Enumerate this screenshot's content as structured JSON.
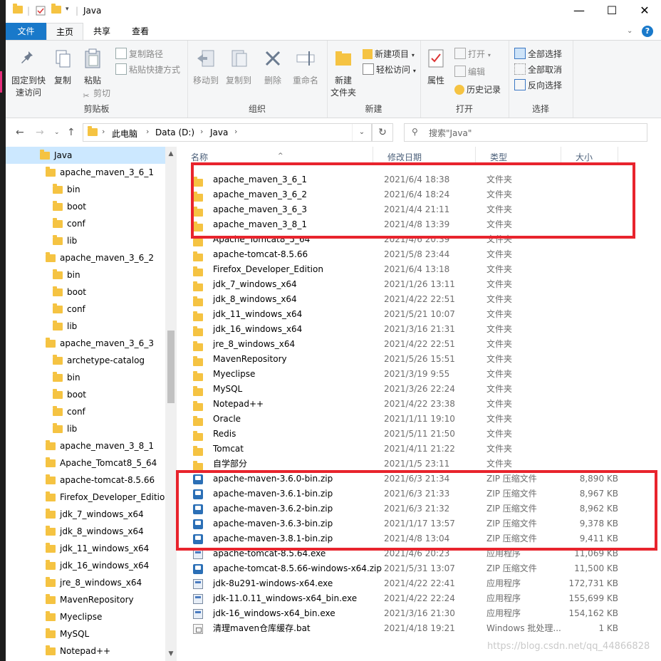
{
  "window": {
    "title": "Java",
    "minimize_glyph": "—",
    "maximize_glyph": "☐",
    "close_glyph": "✕"
  },
  "ribbon_tabs": [
    "文件",
    "主页",
    "共享",
    "查看"
  ],
  "help_glyph": "?",
  "ribbon": {
    "clipboard": {
      "label": "剪贴板",
      "pin_line1": "固定到快",
      "pin_line2": "速访问",
      "copy": "复制",
      "paste": "粘贴",
      "copy_path": "复制路径",
      "paste_shortcut": "粘贴快捷方式",
      "cut": "剪切"
    },
    "organize": {
      "label": "组织",
      "move_to": "移动到",
      "copy_to": "复制到",
      "delete": "删除",
      "rename": "重命名"
    },
    "new": {
      "label": "新建",
      "new_folder_line1": "新建",
      "new_folder_line2": "文件夹",
      "new_item": "新建项目",
      "easy_access": "轻松访问"
    },
    "open": {
      "label": "打开",
      "properties": "属性",
      "open": "打开",
      "edit": "编辑",
      "history": "历史记录"
    },
    "select": {
      "label": "选择",
      "select_all": "全部选择",
      "select_none": "全部取消",
      "invert": "反向选择"
    }
  },
  "address": {
    "crumbs": [
      "此电脑",
      "Data (D:)",
      "Java"
    ],
    "search_placeholder": "搜索\"Java\""
  },
  "tree": [
    {
      "label": "Java",
      "level": 0,
      "selected": true
    },
    {
      "label": "apache_maven_3_6_1",
      "level": 1
    },
    {
      "label": "bin",
      "level": 2
    },
    {
      "label": "boot",
      "level": 2
    },
    {
      "label": "conf",
      "level": 2
    },
    {
      "label": "lib",
      "level": 2
    },
    {
      "label": "apache_maven_3_6_2",
      "level": 1
    },
    {
      "label": "bin",
      "level": 2
    },
    {
      "label": "boot",
      "level": 2
    },
    {
      "label": "conf",
      "level": 2
    },
    {
      "label": "lib",
      "level": 2
    },
    {
      "label": "apache_maven_3_6_3",
      "level": 1
    },
    {
      "label": "archetype-catalog",
      "level": 2
    },
    {
      "label": "bin",
      "level": 2
    },
    {
      "label": "boot",
      "level": 2
    },
    {
      "label": "conf",
      "level": 2
    },
    {
      "label": "lib",
      "level": 2
    },
    {
      "label": "apache_maven_3_8_1",
      "level": 1
    },
    {
      "label": "Apache_Tomcat8_5_64",
      "level": 1
    },
    {
      "label": "apache-tomcat-8.5.66",
      "level": 1
    },
    {
      "label": "Firefox_Developer_Edition",
      "level": 1
    },
    {
      "label": "jdk_7_windows_x64",
      "level": 1
    },
    {
      "label": "jdk_8_windows_x64",
      "level": 1
    },
    {
      "label": "jdk_11_windows_x64",
      "level": 1
    },
    {
      "label": "jdk_16_windows_x64",
      "level": 1
    },
    {
      "label": "jre_8_windows_x64",
      "level": 1
    },
    {
      "label": "MavenRepository",
      "level": 1
    },
    {
      "label": "Myeclipse",
      "level": 1
    },
    {
      "label": "MySQL",
      "level": 1
    },
    {
      "label": "Notepad++",
      "level": 1
    }
  ],
  "columns": {
    "name": "名称",
    "date": "修改日期",
    "type": "类型",
    "size": "大小"
  },
  "files": [
    {
      "name": "apache_maven_3_6_1",
      "date": "2021/6/4 18:38",
      "type": "文件夹",
      "size": "",
      "kind": "folder"
    },
    {
      "name": "apache_maven_3_6_2",
      "date": "2021/6/4 18:24",
      "type": "文件夹",
      "size": "",
      "kind": "folder"
    },
    {
      "name": "apache_maven_3_6_3",
      "date": "2021/4/4 21:11",
      "type": "文件夹",
      "size": "",
      "kind": "folder"
    },
    {
      "name": "apache_maven_3_8_1",
      "date": "2021/4/8 13:39",
      "type": "文件夹",
      "size": "",
      "kind": "folder"
    },
    {
      "name": "Apache_Tomcat8_5_64",
      "date": "2021/4/6 20:39",
      "type": "文件夹",
      "size": "",
      "kind": "folder"
    },
    {
      "name": "apache-tomcat-8.5.66",
      "date": "2021/5/8 23:44",
      "type": "文件夹",
      "size": "",
      "kind": "folder"
    },
    {
      "name": "Firefox_Developer_Edition",
      "date": "2021/6/4 13:18",
      "type": "文件夹",
      "size": "",
      "kind": "folder"
    },
    {
      "name": "jdk_7_windows_x64",
      "date": "2021/1/26 13:11",
      "type": "文件夹",
      "size": "",
      "kind": "folder"
    },
    {
      "name": "jdk_8_windows_x64",
      "date": "2021/4/22 22:51",
      "type": "文件夹",
      "size": "",
      "kind": "folder"
    },
    {
      "name": "jdk_11_windows_x64",
      "date": "2021/5/21 10:07",
      "type": "文件夹",
      "size": "",
      "kind": "folder"
    },
    {
      "name": "jdk_16_windows_x64",
      "date": "2021/3/16 21:31",
      "type": "文件夹",
      "size": "",
      "kind": "folder"
    },
    {
      "name": "jre_8_windows_x64",
      "date": "2021/4/22 22:51",
      "type": "文件夹",
      "size": "",
      "kind": "folder"
    },
    {
      "name": "MavenRepository",
      "date": "2021/5/26 15:51",
      "type": "文件夹",
      "size": "",
      "kind": "folder"
    },
    {
      "name": "Myeclipse",
      "date": "2021/3/19 9:55",
      "type": "文件夹",
      "size": "",
      "kind": "folder"
    },
    {
      "name": "MySQL",
      "date": "2021/3/26 22:24",
      "type": "文件夹",
      "size": "",
      "kind": "folder"
    },
    {
      "name": "Notepad++",
      "date": "2021/4/22 23:38",
      "type": "文件夹",
      "size": "",
      "kind": "folder"
    },
    {
      "name": "Oracle",
      "date": "2021/1/11 19:10",
      "type": "文件夹",
      "size": "",
      "kind": "folder"
    },
    {
      "name": "Redis",
      "date": "2021/5/11 21:50",
      "type": "文件夹",
      "size": "",
      "kind": "folder"
    },
    {
      "name": "Tomcat",
      "date": "2021/4/11 21:22",
      "type": "文件夹",
      "size": "",
      "kind": "folder"
    },
    {
      "name": "自学部分",
      "date": "2021/1/5 23:11",
      "type": "文件夹",
      "size": "",
      "kind": "folder"
    },
    {
      "name": "apache-maven-3.6.0-bin.zip",
      "date": "2021/6/3 21:34",
      "type": "ZIP 压缩文件",
      "size": "8,890 KB",
      "kind": "zip"
    },
    {
      "name": "apache-maven-3.6.1-bin.zip",
      "date": "2021/6/3 21:33",
      "type": "ZIP 压缩文件",
      "size": "8,967 KB",
      "kind": "zip"
    },
    {
      "name": "apache-maven-3.6.2-bin.zip",
      "date": "2021/6/3 21:32",
      "type": "ZIP 压缩文件",
      "size": "8,962 KB",
      "kind": "zip"
    },
    {
      "name": "apache-maven-3.6.3-bin.zip",
      "date": "2021/1/17 13:57",
      "type": "ZIP 压缩文件",
      "size": "9,378 KB",
      "kind": "zip"
    },
    {
      "name": "apache-maven-3.8.1-bin.zip",
      "date": "2021/4/8 13:04",
      "type": "ZIP 压缩文件",
      "size": "9,411 KB",
      "kind": "zip"
    },
    {
      "name": "apache-tomcat-8.5.64.exe",
      "date": "2021/4/6 20:23",
      "type": "应用程序",
      "size": "11,069 KB",
      "kind": "exe"
    },
    {
      "name": "apache-tomcat-8.5.66-windows-x64.zip",
      "date": "2021/5/31 13:07",
      "type": "ZIP 压缩文件",
      "size": "11,500 KB",
      "kind": "zip"
    },
    {
      "name": "jdk-8u291-windows-x64.exe",
      "date": "2021/4/22 22:41",
      "type": "应用程序",
      "size": "172,731 KB",
      "kind": "exe"
    },
    {
      "name": "jdk-11.0.11_windows-x64_bin.exe",
      "date": "2021/4/22 22:24",
      "type": "应用程序",
      "size": "155,699 KB",
      "kind": "exe"
    },
    {
      "name": "jdk-16_windows-x64_bin.exe",
      "date": "2021/3/16 21:30",
      "type": "应用程序",
      "size": "154,162 KB",
      "kind": "exe"
    },
    {
      "name": "清理maven仓库缓存.bat",
      "date": "2021/4/18 19:21",
      "type": "Windows 批处理...",
      "size": "1 KB",
      "kind": "bat"
    }
  ],
  "watermark": "https://blog.csdn.net/qq_44866828",
  "colors": {
    "accent": "#1979ca",
    "highlight": "#e8242d",
    "folder": "#f5c342",
    "selected": "#cce8ff"
  }
}
